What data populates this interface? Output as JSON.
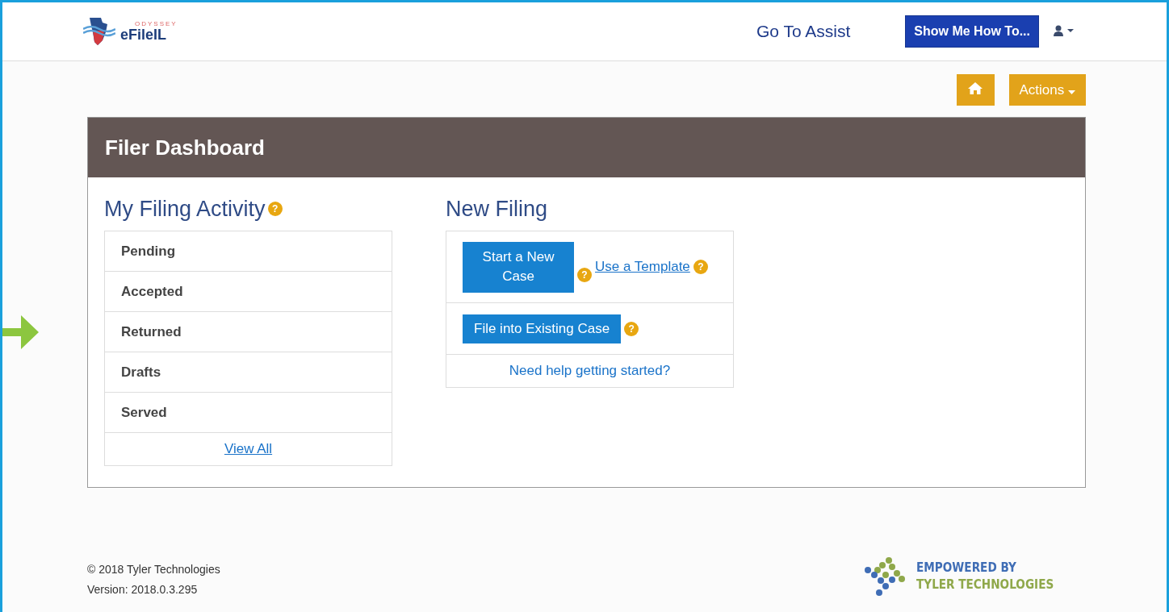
{
  "header": {
    "logo": {
      "top": "ODYSSEY",
      "main": "eFileIL"
    },
    "assist_link": "Go To Assist",
    "help_button": "Show Me How To..."
  },
  "toolbar": {
    "actions_button": "Actions"
  },
  "dashboard": {
    "title": "Filer Dashboard",
    "activity": {
      "heading": "My Filing Activity",
      "help_icon": "?",
      "items": [
        {
          "label": "Pending"
        },
        {
          "label": "Accepted"
        },
        {
          "label": "Returned",
          "highlighted": true
        },
        {
          "label": "Drafts"
        },
        {
          "label": "Served"
        }
      ],
      "view_all": "View All"
    },
    "new_filing": {
      "heading": "New Filing",
      "start_button": "Start a New Case",
      "start_help_icon": "?",
      "template_link": "Use a Template",
      "template_help_icon": "?",
      "existing_button": "File into Existing Case",
      "existing_help_icon": "?",
      "help_link": "Need help getting started?"
    }
  },
  "footer": {
    "copyright": "© 2018 Tyler Technologies",
    "version": "Version: 2018.0.3.295",
    "brand_line_1": "EMPOWERED BY",
    "brand_line_2": "TYLER TECHNOLOGIES"
  }
}
